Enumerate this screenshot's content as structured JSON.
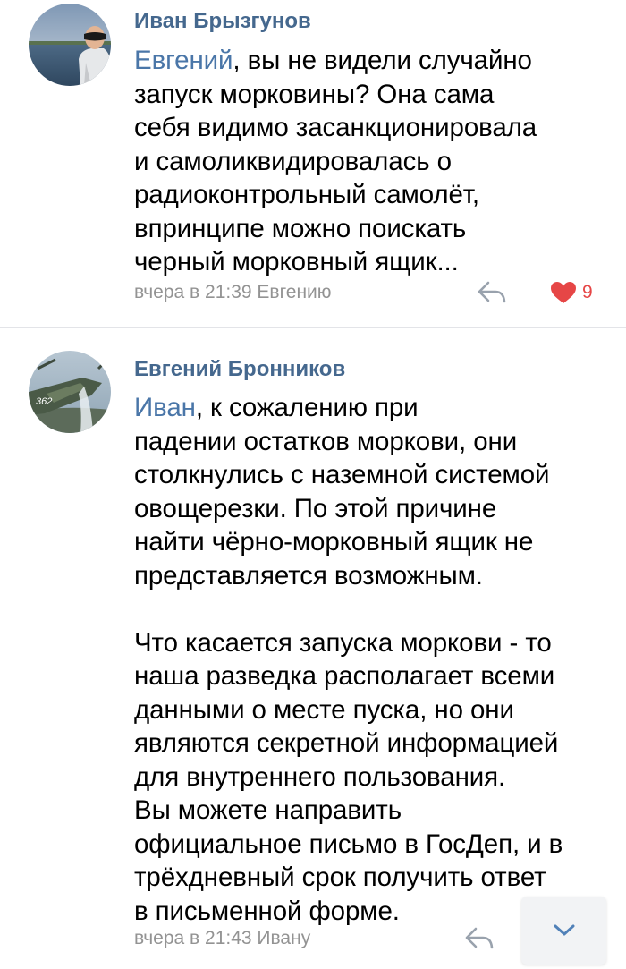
{
  "comments": [
    {
      "author": "Иван Брызгунов",
      "mention": "Евгений",
      "text": ", вы не видели случайно\nзапуск морковины? Она сама\nсебя видимо засанкционировала\nи самоликвидировалась о\nрадиоконтрольный самолёт,\nвпринципе можно поискать\nчерный морковный ящик...",
      "meta": "вчера в 21:39 Евгению",
      "likes": "9"
    },
    {
      "author": "Евгений Бронников",
      "mention": "Иван",
      "text": ", к сожалению при\nпадении остатков моркови, они\nстолкнулись с наземной системой\nовощерезки. По этой причине\nнайти чёрно-морковный ящик не\nпредставляется возможным.\n\nЧто касается запуска моркови - то\nнаша разведка располагает всеми\nданными о месте пуска, но они\nявляются секретной информацией\nдля внутреннего пользования.\nВы можете направить\nофициальное письмо в ГосДеп, и в\nтрёхдневный срок получить ответ\nв письменной форме.",
      "meta": "вчера в 21:43 Ивану",
      "avatar_label": "362"
    }
  ],
  "colors": {
    "author": "#45688e",
    "mention": "#4a76a8",
    "meta": "#939393",
    "like": "#e64646"
  },
  "icons": {
    "reply": "reply-arrow-icon",
    "like": "heart-icon",
    "scroll": "chevron-down-icon"
  }
}
